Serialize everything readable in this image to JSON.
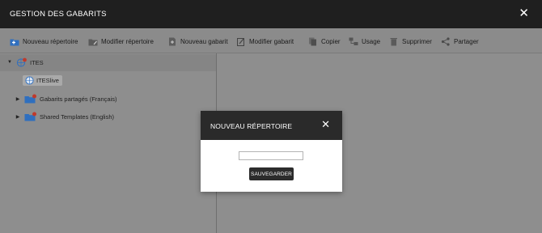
{
  "window": {
    "title": "GESTION DES GABARITS",
    "close_label": "✕"
  },
  "toolbar": {
    "items": [
      {
        "label": "Nouveau répertoire",
        "icon": "new-folder-icon"
      },
      {
        "label": "Modifier répertoire",
        "icon": "edit-folder-icon"
      },
      {
        "label": "Nouveau gabarit",
        "icon": "new-template-icon"
      },
      {
        "label": "Modifier gabarit",
        "icon": "edit-template-icon"
      },
      {
        "label": "Copier",
        "icon": "copy-icon"
      },
      {
        "label": "Usage",
        "icon": "usage-icon"
      },
      {
        "label": "Supprimer",
        "icon": "trash-icon"
      },
      {
        "label": "Partager",
        "icon": "share-icon"
      }
    ]
  },
  "tree": {
    "root": {
      "label": "ITES",
      "expanded": true
    },
    "children": [
      {
        "label": "ITESlive",
        "selected": true
      },
      {
        "label": "Gabarits partagés (Français)",
        "expanded": false
      },
      {
        "label": "Shared Templates (English)",
        "expanded": false
      }
    ]
  },
  "dialog": {
    "title": "NOUVEAU RÉPERTOIRE",
    "close_label": "✕",
    "input_value": "",
    "save_label": "SAUVEGARDER"
  },
  "colors": {
    "titlebar": "#1f1f1f",
    "overlay_background": "#8e8e8e",
    "dialog_header": "#2a2a2a",
    "save_button": "#2c2c2c",
    "accent_blue": "#2f6fbf",
    "badge_red": "#c0392b"
  }
}
